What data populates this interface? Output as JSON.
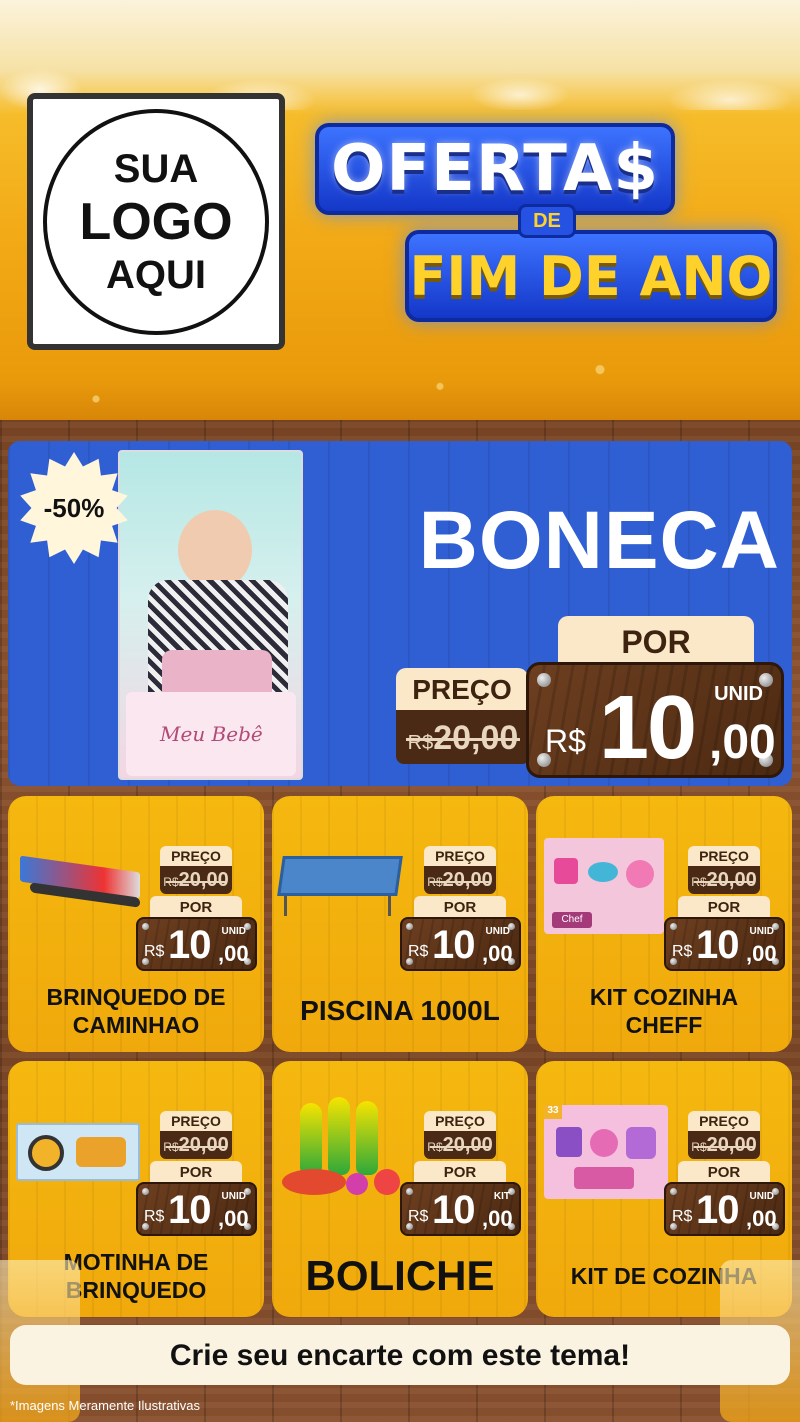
{
  "header": {
    "logo_line1": "SUA",
    "logo_line2": "LOGO",
    "logo_line3": "AQUI",
    "title_top": "OFERTA$",
    "title_de": "DE",
    "title_bottom": "FIM DE ANO"
  },
  "featured": {
    "badge": "-50%",
    "name": "BONECA",
    "box_brand_text": "Meu Bebê",
    "por_label": "POR",
    "preco_label": "PREÇO",
    "old_currency": "R$",
    "old_value": "20,00",
    "unit": "UNID",
    "new_currency": "R$",
    "new_int": "10",
    "new_dec": ",00"
  },
  "products": [
    {
      "name": "BRINQUEDO DE CAMINHAO",
      "preco_label": "PREÇO",
      "old_currency": "R$",
      "old_value": "20,00",
      "por_label": "POR",
      "unit": "UNID",
      "new_currency": "R$",
      "new_int": "10",
      "new_dec": ",00"
    },
    {
      "name": "PISCINA 1000L",
      "preco_label": "PREÇO",
      "old_currency": "R$",
      "old_value": "20,00",
      "por_label": "POR",
      "unit": "UNID",
      "new_currency": "R$",
      "new_int": "10",
      "new_dec": ",00"
    },
    {
      "name": "KIT COZINHA CHEFF",
      "preco_label": "PREÇO",
      "old_currency": "R$",
      "old_value": "20,00",
      "por_label": "POR",
      "unit": "UNID",
      "new_currency": "R$",
      "new_int": "10",
      "new_dec": ",00"
    },
    {
      "name": "MOTINHA DE BRINQUEDO",
      "preco_label": "PREÇO",
      "old_currency": "R$",
      "old_value": "20,00",
      "por_label": "POR",
      "unit": "UNID",
      "new_currency": "R$",
      "new_int": "10",
      "new_dec": ",00"
    },
    {
      "name": "BOLICHE",
      "preco_label": "PREÇO",
      "old_currency": "R$",
      "old_value": "20,00",
      "por_label": "POR",
      "unit": "KIT",
      "new_currency": "R$",
      "new_int": "10",
      "new_dec": ",00"
    },
    {
      "name": "KIT DE COZINHA",
      "preco_label": "PREÇO",
      "old_currency": "R$",
      "old_value": "20,00",
      "por_label": "POR",
      "unit": "UNID",
      "new_currency": "R$",
      "new_int": "10",
      "new_dec": ",00"
    }
  ],
  "footer": {
    "cta": "Crie seu encarte com este tema!",
    "disclaimer": "*Imagens Meramente Ilustrativas"
  },
  "colors": {
    "beer": "#f2a814",
    "banner_blue": "#2f5fd3",
    "wood": "#7a4625",
    "card_yellow": "#f5b80f",
    "title_yellow": "#ffd22b"
  }
}
